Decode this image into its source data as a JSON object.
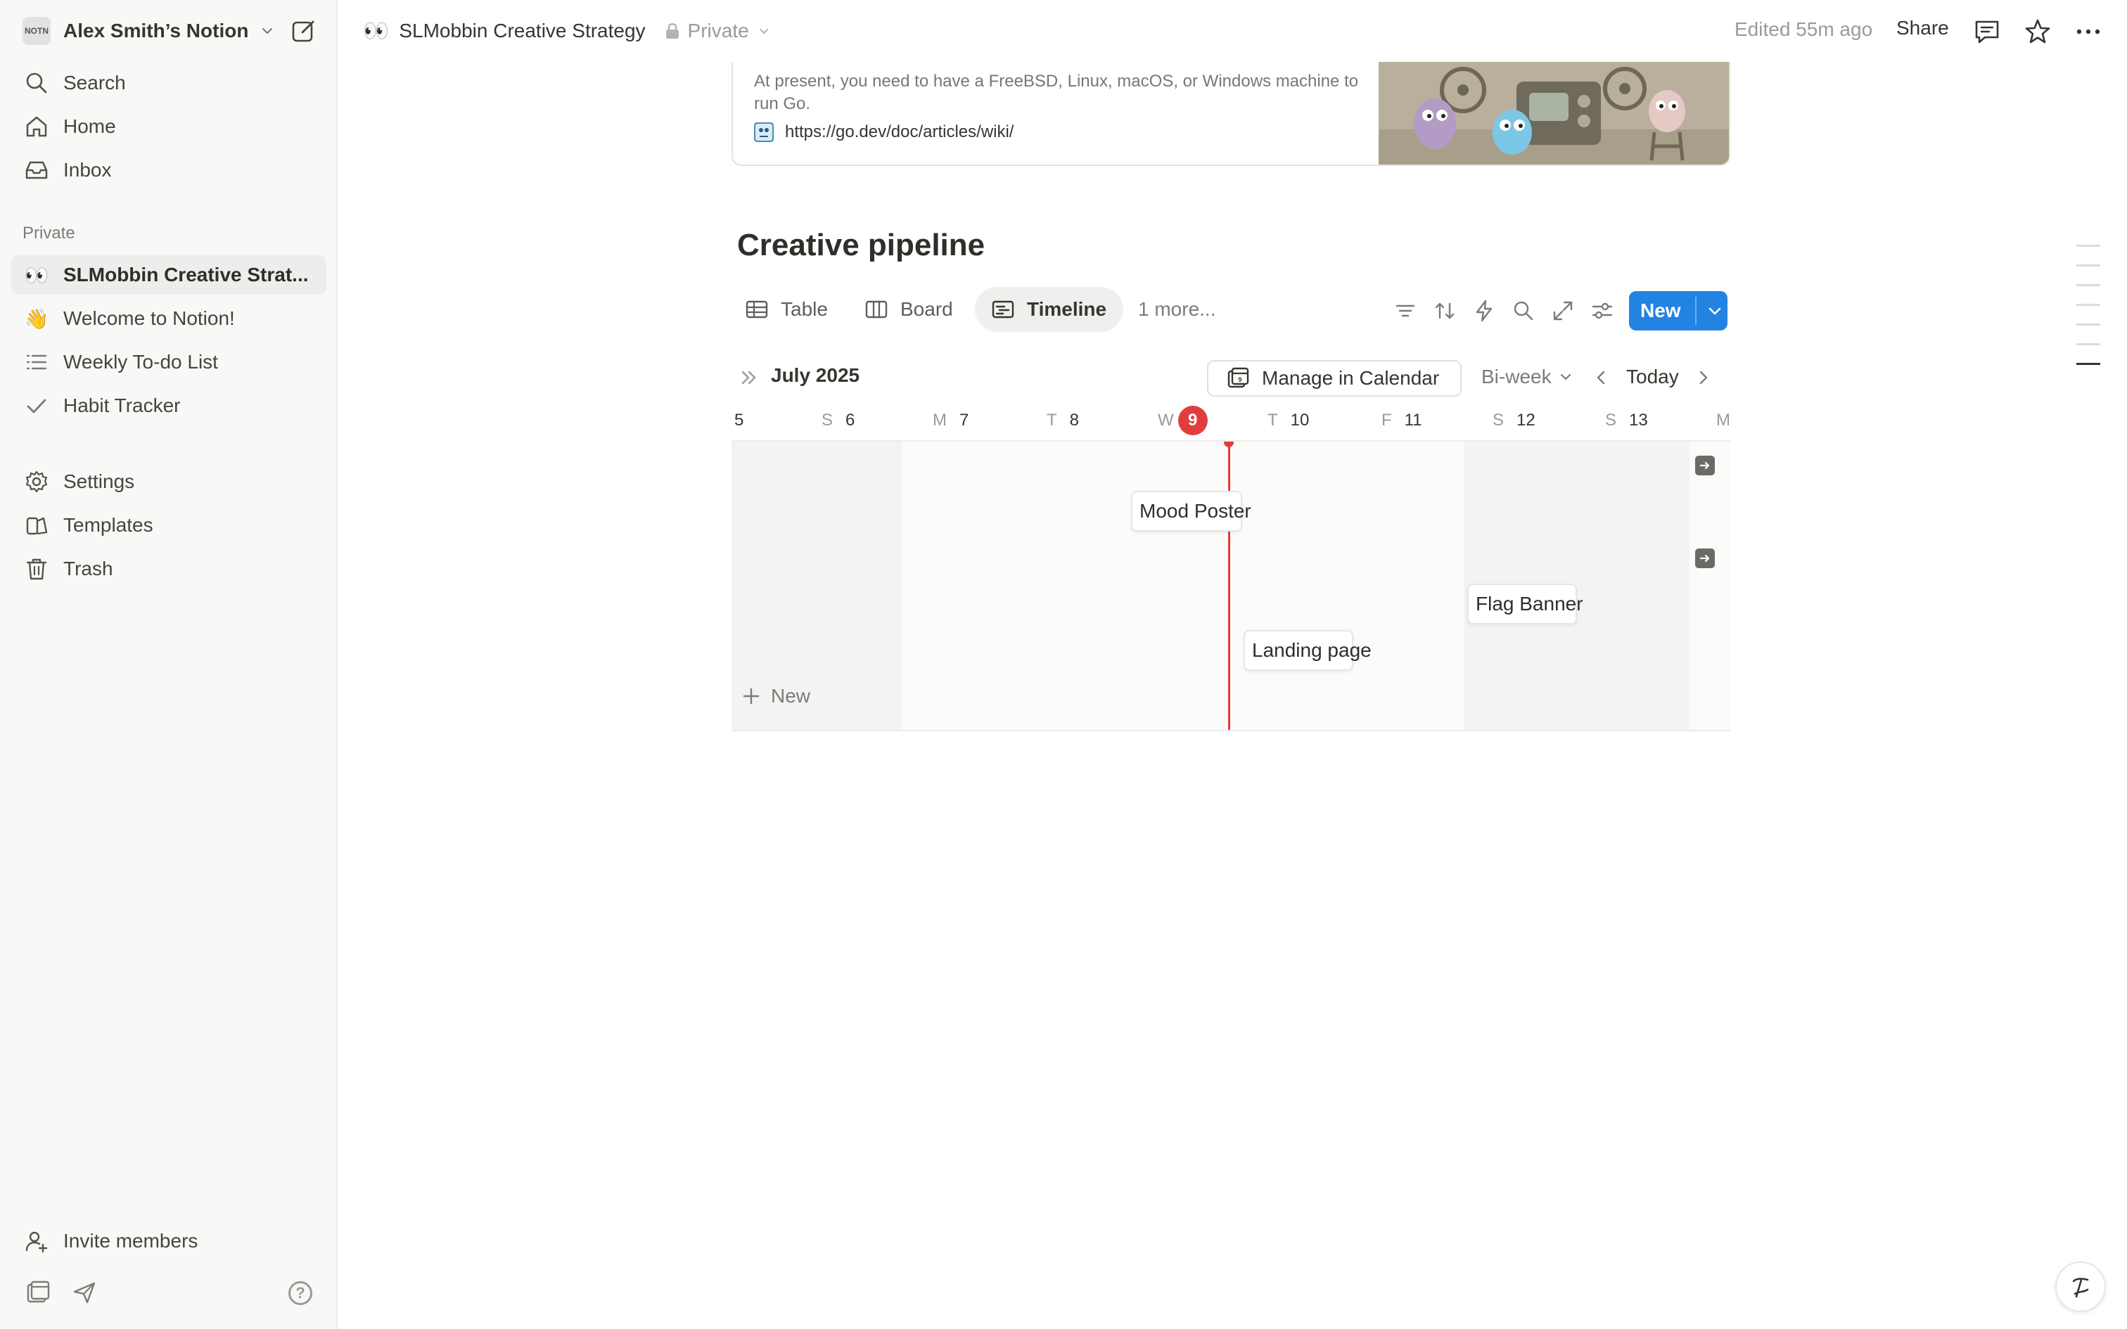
{
  "sidebar": {
    "workspace_name": "Alex Smith’s Notion",
    "workspace_avatar": "NOTN",
    "nav": [
      {
        "label": "Search",
        "icon": "search-icon"
      },
      {
        "label": "Home",
        "icon": "home-icon"
      },
      {
        "label": "Inbox",
        "icon": "inbox-icon"
      }
    ],
    "section_label": "Private",
    "pages": [
      {
        "label": "SLMobbin Creative Strat...",
        "emoji": "👀"
      },
      {
        "label": "Welcome to Notion!",
        "emoji": "👋"
      },
      {
        "label": "Weekly To-do List",
        "icon": "list-icon"
      },
      {
        "label": "Habit Tracker",
        "icon": "check-icon"
      }
    ],
    "utility": [
      {
        "label": "Settings",
        "icon": "gear-icon"
      },
      {
        "label": "Templates",
        "icon": "templates-icon"
      },
      {
        "label": "Trash",
        "icon": "trash-icon"
      }
    ],
    "invite_label": "Invite members",
    "help_label": "?"
  },
  "topbar": {
    "page_emoji": "👀",
    "page_title": "SLMobbin Creative Strategy",
    "privacy": "Private",
    "edited": "Edited 55m ago",
    "share_label": "Share"
  },
  "bookmark": {
    "description": "At present, you need to have a FreeBSD, Linux, macOS, or Windows machine to run Go.",
    "url": "https://go.dev/doc/articles/wiki/"
  },
  "database": {
    "title": "Creative pipeline",
    "views": [
      {
        "label": "Table",
        "icon": "table-icon"
      },
      {
        "label": "Board",
        "icon": "board-icon"
      },
      {
        "label": "Timeline",
        "icon": "timeline-icon",
        "active": true
      }
    ],
    "more_views": "1 more...",
    "new_label": "New",
    "tools": [
      "filter-icon",
      "sort-icon",
      "automation-icon",
      "search-icon",
      "expand-icon",
      "settings-icon"
    ]
  },
  "timeline": {
    "month": "July 2025",
    "calendar_button": "Manage in Calendar",
    "range": "Bi-week",
    "today_label": "Today",
    "days": [
      {
        "dow": "",
        "num": "5"
      },
      {
        "dow": "S",
        "num": "6"
      },
      {
        "dow": "M",
        "num": "7"
      },
      {
        "dow": "T",
        "num": "8"
      },
      {
        "dow": "W",
        "num": "9",
        "today": true
      },
      {
        "dow": "T",
        "num": "10"
      },
      {
        "dow": "F",
        "num": "11"
      },
      {
        "dow": "S",
        "num": "12"
      },
      {
        "dow": "S",
        "num": "13"
      },
      {
        "dow": "M",
        "num": ""
      }
    ],
    "items": [
      {
        "label": "Mood Poster"
      },
      {
        "label": "Flag Banner"
      },
      {
        "label": "Landing page"
      }
    ],
    "new_row_label": "New"
  },
  "colors": {
    "accent": "#2383e2",
    "today": "#e03e3e",
    "sidebar_bg": "#f8f8f7"
  }
}
